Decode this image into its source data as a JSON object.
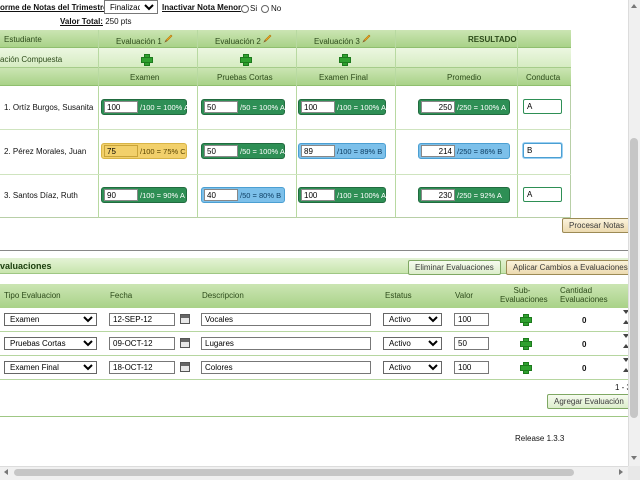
{
  "top": {
    "report_label": "orme de Notas del Trimestre",
    "status_value": "Finalizado",
    "inactivar_label": "Inactivar Nota Menor",
    "radio_si": "Si",
    "radio_no": "No",
    "valor_total_label": "Valor Total:",
    "valor_total_value": "250 pts"
  },
  "grid": {
    "header": {
      "estudiante": "Estudiante",
      "evaluacion1": "Evaluación 1",
      "evaluacion2": "Evaluación 2",
      "evaluacion3": "Evaluación 3",
      "resultado": "RESULTADO"
    },
    "composite_label": "ación Compuesta",
    "columns": {
      "examen": "Examen",
      "pruebas_cortas": "Pruebas Cortas",
      "examen_final": "Examen Final",
      "promedio": "Promedio",
      "conducta": "Conducta"
    },
    "students": [
      {
        "name": "1. Ortíz Burgos, Susanita",
        "examen": {
          "value": "100",
          "text": "/100 = 100% A",
          "color": "green"
        },
        "pruebas": {
          "value": "50",
          "text": "/50 = 100% A",
          "color": "green"
        },
        "final": {
          "value": "100",
          "text": "/100 = 100% A",
          "color": "green"
        },
        "promedio": {
          "value": "250",
          "text": "/250 = 100% A",
          "color": "green"
        },
        "conducta": "A",
        "conducta_color": "green"
      },
      {
        "name": "2. Pérez Morales, Juan",
        "examen": {
          "value": "75",
          "text": "/100 = 75% C",
          "color": "yellow"
        },
        "pruebas": {
          "value": "50",
          "text": "/50 = 100% A",
          "color": "green"
        },
        "final": {
          "value": "89",
          "text": "/100 = 89% B",
          "color": "blue"
        },
        "promedio": {
          "value": "214",
          "text": "/250 = 86% B",
          "color": "blue"
        },
        "conducta": "B",
        "conducta_color": "blue"
      },
      {
        "name": "3. Santos Díaz, Ruth",
        "examen": {
          "value": "90",
          "text": "/100 = 90% A",
          "color": "green"
        },
        "pruebas": {
          "value": "40",
          "text": "/50 = 80% B",
          "color": "blue"
        },
        "final": {
          "value": "100",
          "text": "/100 = 100% A",
          "color": "green"
        },
        "promedio": {
          "value": "230",
          "text": "/250 = 92% A",
          "color": "green"
        },
        "conducta": "A",
        "conducta_color": "green"
      }
    ],
    "procesar_button": "Procesar Notas"
  },
  "evaluaciones": {
    "title": "valuaciones",
    "eliminar_button": "Eliminar Evaluaciones",
    "aplicar_button": "Aplicar Cambios a Evaluaciones",
    "columns": {
      "tipo": "Tipo Evaluacion",
      "fecha": "Fecha",
      "descripcion": "Descripcion",
      "estatus": "Estatus",
      "valor": "Valor",
      "sub": "Sub-Evaluaciones",
      "cantidad": "Cantidad Evaluaciones"
    },
    "rows": [
      {
        "tipo": "Examen",
        "fecha": "12-SEP-12",
        "descripcion": "Vocales",
        "estatus": "Activo",
        "valor": "100",
        "cantidad": "0"
      },
      {
        "tipo": "Pruebas Cortas",
        "fecha": "09-OCT-12",
        "descripcion": "Lugares",
        "estatus": "Activo",
        "valor": "50",
        "cantidad": "0"
      },
      {
        "tipo": "Examen Final",
        "fecha": "18-OCT-12",
        "descripcion": "Colores",
        "estatus": "Activo",
        "valor": "100",
        "cantidad": "0"
      }
    ],
    "pagination": "1 - 3",
    "agregar_button": "Agregar Evaluación"
  },
  "footer": {
    "release": "Release 1.3.3"
  },
  "colors": {
    "green_pill": "#2e8f55",
    "yellow_pill": "#f2d06b",
    "blue_pill": "#7cc0ea",
    "header_green": "#a9d288"
  }
}
